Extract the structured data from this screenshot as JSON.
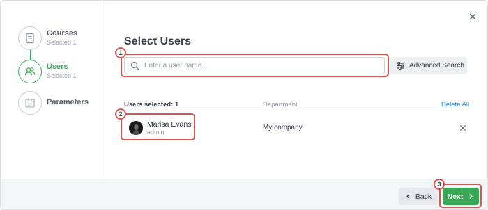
{
  "steps": [
    {
      "title": "Courses",
      "subtitle": "Selected 1",
      "icon": "document-icon",
      "state": "done"
    },
    {
      "title": "Users",
      "subtitle": "Selected 1",
      "icon": "users-icon",
      "state": "active"
    },
    {
      "title": "Parameters",
      "subtitle": "",
      "icon": "calendar-icon",
      "state": "pending"
    }
  ],
  "main": {
    "title": "Select Users",
    "search_placeholder": "Enter a user name...",
    "advanced_search_label": "Advanced Search"
  },
  "table": {
    "selected_label": "Users selected: 1",
    "department_header": "Department",
    "delete_all_label": "Delete All",
    "rows": [
      {
        "name": "Marisa Evans",
        "role": "admin",
        "department": "My company"
      }
    ]
  },
  "footer": {
    "back_label": "Back",
    "next_label": "Next"
  },
  "callouts": [
    "1",
    "2",
    "3"
  ],
  "colors": {
    "accent_green": "#3aa856",
    "link_blue": "#2a84d2",
    "callout_red": "#d9534f"
  }
}
